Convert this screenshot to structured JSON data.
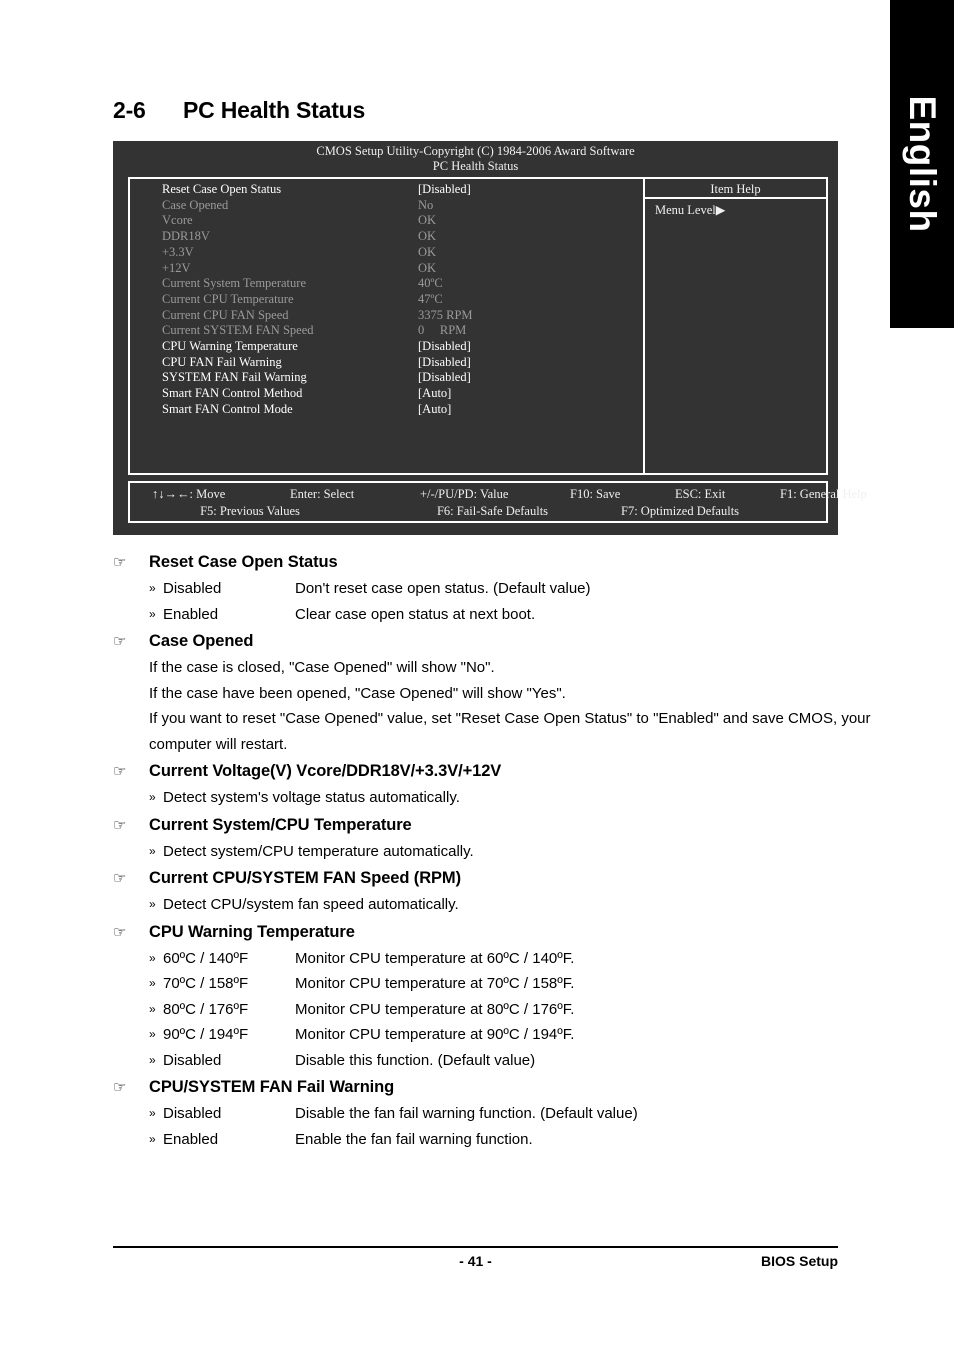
{
  "language_tab": {
    "label": "English"
  },
  "section": {
    "number": "2-6",
    "title": "PC Health Status"
  },
  "bios": {
    "title": "CMOS Setup Utility-Copyright (C) 1984-2006 Award Software",
    "subtitle": "PC Health Status",
    "item_help_header": "Item Help",
    "menu_level": "Menu Level▶",
    "rows": [
      {
        "label": "Reset Case Open Status",
        "value": "[Disabled]",
        "state": "active"
      },
      {
        "label": "Case Opened",
        "value": "No",
        "state": "dim"
      },
      {
        "label": "Vcore",
        "value": "OK",
        "state": "dim"
      },
      {
        "label": "DDR18V",
        "value": "OK",
        "state": "dim"
      },
      {
        "label": "+3.3V",
        "value": "OK",
        "state": "dim"
      },
      {
        "label": "+12V",
        "value": "OK",
        "state": "dim"
      },
      {
        "label": "Current System Temperature",
        "value": "40ºC",
        "state": "dim"
      },
      {
        "label": "Current CPU Temperature",
        "value": "47ºC",
        "state": "dim"
      },
      {
        "label": "Current CPU FAN Speed",
        "value": "3375 RPM",
        "state": "dim"
      },
      {
        "label": "Current SYSTEM FAN Speed",
        "value": "0     RPM",
        "state": "dim"
      },
      {
        "label": "CPU Warning Temperature",
        "value": "[Disabled]",
        "state": "active"
      },
      {
        "label": "CPU FAN Fail Warning",
        "value": "[Disabled]",
        "state": "active"
      },
      {
        "label": "SYSTEM FAN Fail Warning",
        "value": "[Disabled]",
        "state": "active"
      },
      {
        "label": "Smart FAN Control Method",
        "value": "[Auto]",
        "state": "active"
      },
      {
        "label": "Smart FAN Control Mode",
        "value": "[Auto]",
        "state": "active"
      }
    ],
    "footer": {
      "move": "↑↓→←: Move",
      "enter": "Enter: Select",
      "value": "+/-/PU/PD: Value",
      "save": "F10: Save",
      "exit": "ESC: Exit",
      "help": "F1: General Help",
      "prev": "F5: Previous Values",
      "failsafe": "F6: Fail-Safe Defaults",
      "optimized": "F7: Optimized Defaults"
    }
  },
  "sections": [
    {
      "heading": "Reset Case Open Status",
      "options": [
        {
          "name": "Disabled",
          "desc": "Don't reset case open status. (Default value)"
        },
        {
          "name": "Enabled",
          "desc": "Clear case open status at next boot."
        }
      ]
    },
    {
      "heading": "Case Opened",
      "paragraphs": [
        "If the case is closed, \"Case Opened\" will show \"No\".",
        "If the case have been opened, \"Case Opened\" will show \"Yes\".",
        "If you want to reset \"Case Opened\" value, set \"Reset Case Open Status\" to \"Enabled\" and save CMOS, your computer will restart."
      ]
    },
    {
      "heading": "Current Voltage(V) Vcore/DDR18V/+3.3V/+12V",
      "options": [
        {
          "name": "Detect system's voltage status automatically.",
          "desc": ""
        }
      ]
    },
    {
      "heading": "Current System/CPU Temperature",
      "options": [
        {
          "name": "Detect system/CPU temperature automatically.",
          "desc": ""
        }
      ]
    },
    {
      "heading": "Current CPU/SYSTEM FAN Speed (RPM)",
      "options": [
        {
          "name": "Detect CPU/system fan speed automatically.",
          "desc": ""
        }
      ]
    },
    {
      "heading": "CPU Warning Temperature",
      "options": [
        {
          "name": "60ºC / 140ºF",
          "desc": "Monitor CPU temperature at 60ºC / 140ºF."
        },
        {
          "name": "70ºC / 158ºF",
          "desc": "Monitor CPU temperature at 70ºC / 158ºF."
        },
        {
          "name": "80ºC / 176ºF",
          "desc": "Monitor CPU temperature at 80ºC / 176ºF."
        },
        {
          "name": "90ºC / 194ºF",
          "desc": "Monitor CPU temperature at 90ºC / 194ºF."
        },
        {
          "name": "Disabled",
          "desc": "Disable this function. (Default value)"
        }
      ]
    },
    {
      "heading": "CPU/SYSTEM FAN Fail Warning",
      "options": [
        {
          "name": "Disabled",
          "desc": "Disable the fan fail warning function. (Default value)"
        },
        {
          "name": "Enabled",
          "desc": "Enable the fan fail warning function."
        }
      ]
    }
  ],
  "page_footer": {
    "page_number": "- 41 -",
    "doc_label": "BIOS Setup"
  },
  "icons": {
    "hand": "☞",
    "chevron": "»",
    "arrow": "▶"
  }
}
